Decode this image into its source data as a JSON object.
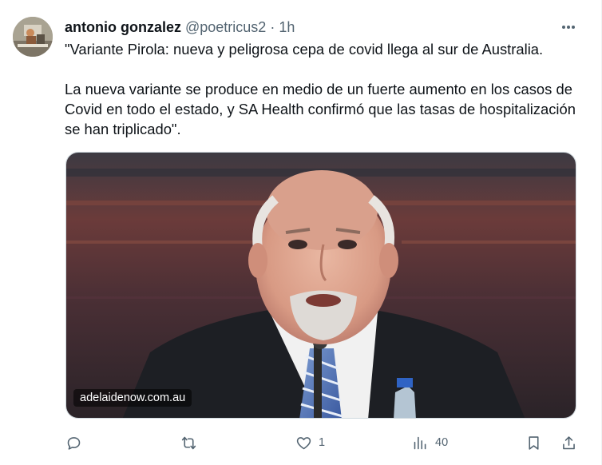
{
  "tweet": {
    "author_name": "antonio gonzalez",
    "handle": "@poetricus2",
    "separator": "·",
    "time": "1h",
    "more_icon": "ellipsis-icon",
    "text_p1": "\"Variante Pirola: nueva y peligrosa cepa de covid llega al sur de Australia.",
    "text_p2": "La nueva variante se produce en medio de un fuerte aumento en los casos de Covid en todo el estado, y SA Health confirmó que las tasas de hospitalización se han triplicado\".",
    "link_domain": "adelaidenow.com.au"
  },
  "actions": {
    "reply_icon": "reply-icon",
    "repost_icon": "repost-icon",
    "like_icon": "heart-icon",
    "like_count": "1",
    "views_icon": "views-chart-icon",
    "views_count": "40",
    "bookmark_icon": "bookmark-icon",
    "share_icon": "share-icon"
  },
  "colors": {
    "text": "#0f1419",
    "secondary": "#536471",
    "border": "#cfd9de"
  }
}
